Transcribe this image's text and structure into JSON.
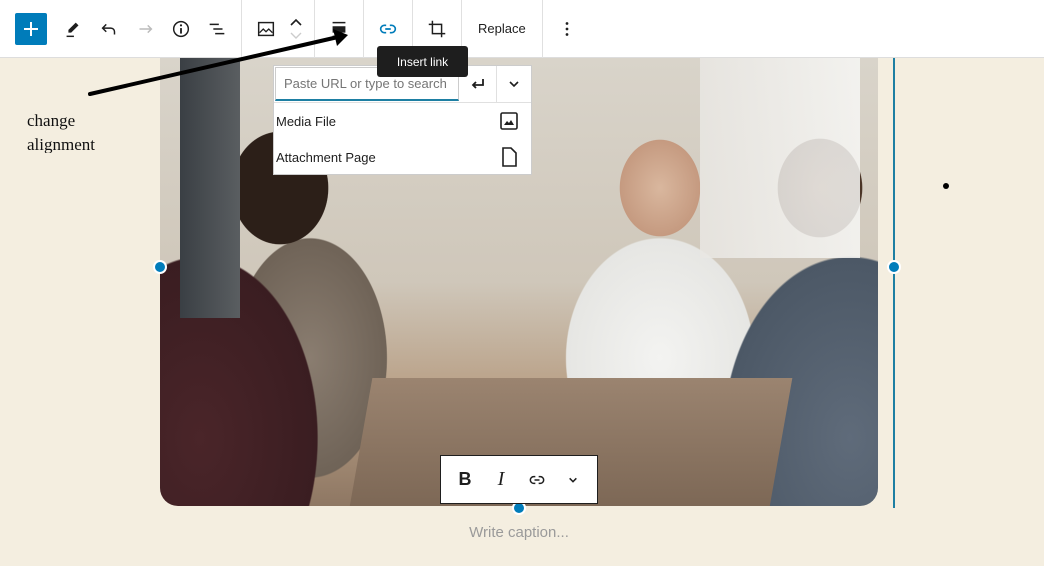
{
  "toolbar": {
    "add_block_label": "Add block",
    "items": [
      {
        "icon": "pencil-icon",
        "label": "Tools"
      },
      {
        "icon": "undo-icon",
        "label": "Undo"
      },
      {
        "icon": "redo-icon",
        "label": "Redo",
        "disabled": true
      },
      {
        "icon": "info-icon",
        "label": "Details"
      },
      {
        "icon": "list-view-icon",
        "label": "List View"
      }
    ],
    "block_type_icon": "image-icon",
    "align_icon": "align-icon",
    "link_icon": "link-icon",
    "crop_icon": "crop-icon",
    "replace_label": "Replace",
    "more_icon": "more-vertical-icon"
  },
  "tooltip": {
    "text": "Insert link"
  },
  "link_popover": {
    "input_placeholder": "Paste URL or type to search",
    "input_value": "",
    "options": [
      {
        "label": "Media File",
        "icon": "media-icon"
      },
      {
        "label": "Attachment Page",
        "icon": "page-icon"
      }
    ]
  },
  "annotation": {
    "text_line1": "change",
    "text_line2": "alignment"
  },
  "caption_toolbar": {
    "bold": "B",
    "italic": "I"
  },
  "caption": {
    "placeholder": "Write caption..."
  },
  "colors": {
    "accent": "#007cba",
    "background": "#f4eee0",
    "selection": "#1d7fa3"
  }
}
